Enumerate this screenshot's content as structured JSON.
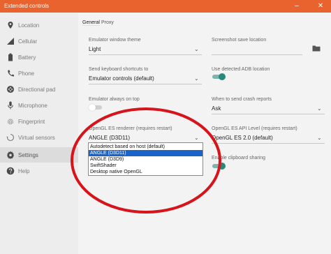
{
  "window": {
    "title": "Extended controls"
  },
  "sidebar": {
    "items": [
      {
        "label": "Location",
        "icon": "location-pin-icon"
      },
      {
        "label": "Cellular",
        "icon": "signal-icon"
      },
      {
        "label": "Battery",
        "icon": "battery-icon"
      },
      {
        "label": "Phone",
        "icon": "phone-icon"
      },
      {
        "label": "Directional pad",
        "icon": "dpad-icon"
      },
      {
        "label": "Microphone",
        "icon": "microphone-icon"
      },
      {
        "label": "Fingerprint",
        "icon": "fingerprint-icon"
      },
      {
        "label": "Virtual sensors",
        "icon": "rotation-icon"
      },
      {
        "label": "Settings",
        "icon": "gear-icon"
      },
      {
        "label": "Help",
        "icon": "help-icon"
      }
    ],
    "selected": "Settings"
  },
  "tabs": [
    {
      "label": "General"
    },
    {
      "label": "Proxy"
    }
  ],
  "settings": {
    "theme": {
      "label": "Emulator window theme",
      "value": "Light"
    },
    "screenshot": {
      "label": "Screenshot save location",
      "value": ""
    },
    "shortcuts": {
      "label": "Send keyboard shortcuts to",
      "value": "Emulator controls (default)"
    },
    "adb": {
      "label": "Use detected ADB location",
      "on": true
    },
    "always_on_top": {
      "label": "Emulator always on top",
      "on": false
    },
    "crash": {
      "label": "When to send crash reports",
      "value": "Ask"
    },
    "renderer": {
      "label": "OpenGL ES renderer (requires restart)",
      "value": "ANGLE (D3D11)",
      "options": [
        "Autodetect based on host (default)",
        "ANGLE (D3D11)",
        "ANGLE (D3D9)",
        "SwiftShader",
        "Desktop native OpenGL"
      ],
      "selected_option": "ANGLE (D3D11)"
    },
    "api_level": {
      "label": "OpenGL ES API Level (requires restart)",
      "value": "OpenGL ES 2.0 (default)"
    },
    "clipboard": {
      "label": "Enable clipboard sharing",
      "on": true
    }
  },
  "colors": {
    "titlebar": "#e8632d",
    "toggle_on": "#26897b",
    "selection": "#1a63c8",
    "annotation": "#d6141c"
  }
}
